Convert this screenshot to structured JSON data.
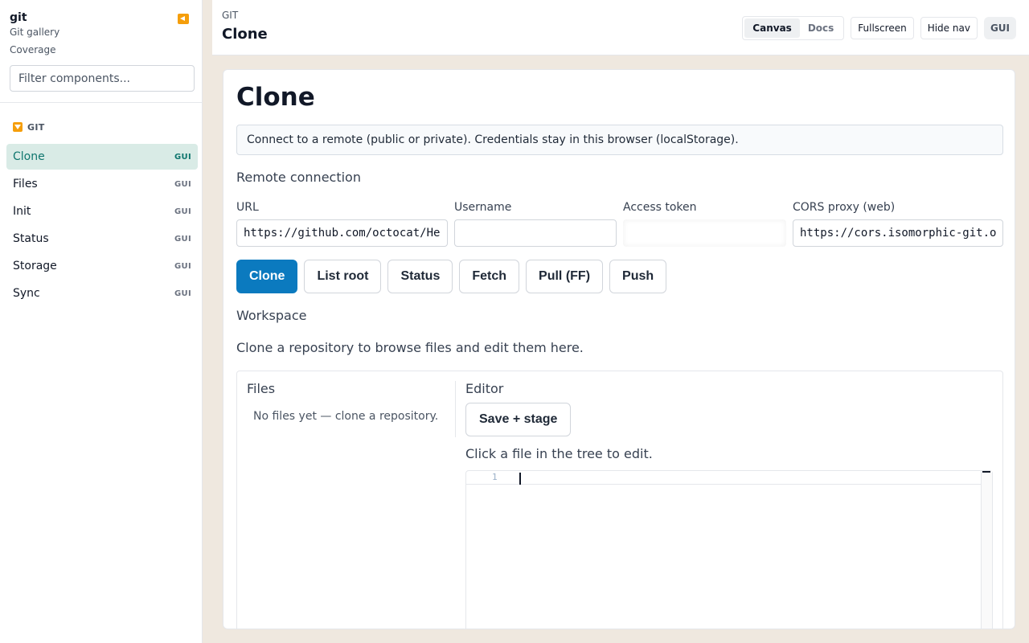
{
  "sidebar": {
    "title": "git",
    "subtitle": "Git gallery",
    "link": "Coverage",
    "filter_placeholder": "Filter components...",
    "group": "GIT",
    "items": [
      {
        "label": "Clone",
        "tag": "GUI"
      },
      {
        "label": "Files",
        "tag": "GUI"
      },
      {
        "label": "Init",
        "tag": "GUI"
      },
      {
        "label": "Status",
        "tag": "GUI"
      },
      {
        "label": "Storage",
        "tag": "GUI"
      },
      {
        "label": "Sync",
        "tag": "GUI"
      }
    ]
  },
  "topbar": {
    "crumb": "GIT",
    "title": "Clone",
    "seg_canvas": "Canvas",
    "seg_docs": "Docs",
    "fullscreen": "Fullscreen",
    "hide_nav": "Hide nav",
    "gui": "GUI"
  },
  "main": {
    "heading": "Clone",
    "info": "Connect to a remote (public or private). Credentials stay in this browser (localStorage).",
    "remote_title": "Remote connection",
    "fields": {
      "url_label": "URL",
      "url_value": "https://github.com/octocat/He",
      "username_label": "Username",
      "username_value": "",
      "token_label": "Access token",
      "token_value": "",
      "cors_label": "CORS proxy (web)",
      "cors_value": "https://cors.isomorphic-git.o"
    },
    "buttons": {
      "clone": "Clone",
      "list_root": "List root",
      "status": "Status",
      "fetch": "Fetch",
      "pull": "Pull (FF)",
      "push": "Push"
    },
    "workspace_title": "Workspace",
    "workspace_hint": "Clone a repository to browse files and edit them here.",
    "files_title": "Files",
    "files_empty": "No files yet — clone a repository.",
    "editor_title": "Editor",
    "save_stage": "Save + stage",
    "editor_hint": "Click a file in the tree to edit.",
    "line_number": "1"
  },
  "colors": {
    "accent": "#0b7abf",
    "active_bg": "#d9ebe6",
    "active_text": "#0f766e",
    "brand_orange": "#f59e0b",
    "page_bg": "#efe8df"
  }
}
